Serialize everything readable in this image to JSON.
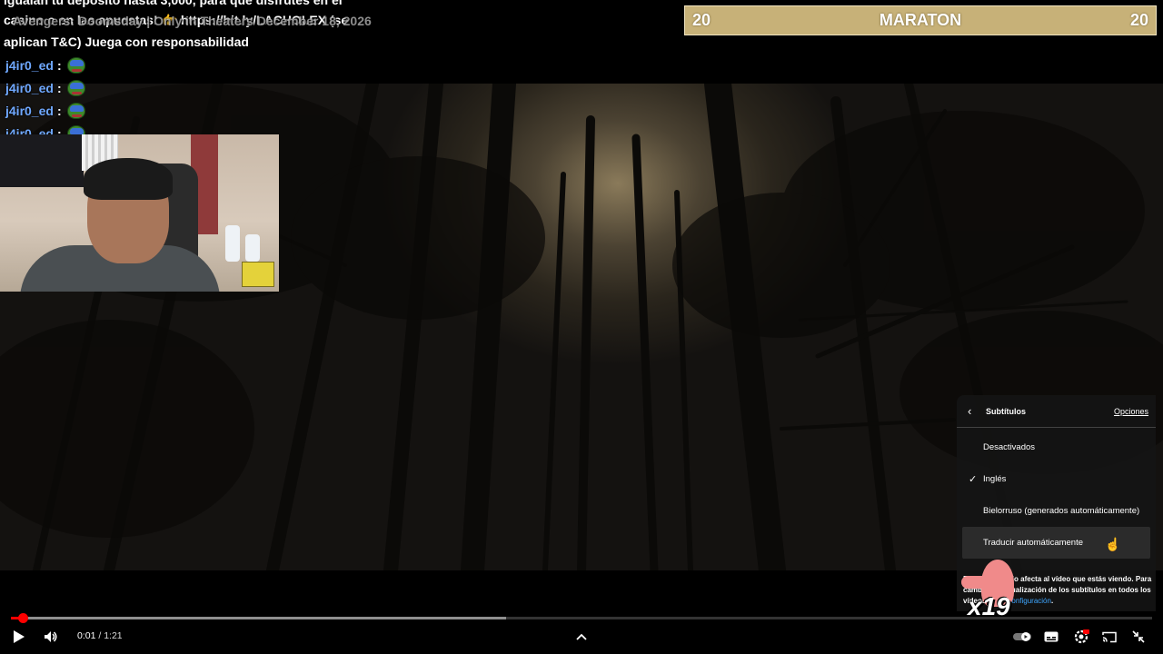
{
  "chat": {
    "headline_line1": "igualan tu depósito hasta 3,000, para que disfrutes en el",
    "headline_line2": "casino o en las apuestas! 👉 https://bit.ly/LACHOLEX (se",
    "headline_line3": "aplican T&C) Juega con responsabilidad",
    "headline_ghost": "Avengers: Doomsday | Only in Theaters December 18, 2026",
    "messages": [
      {
        "user": "j4ir0_ed",
        "sep": ":"
      },
      {
        "user": "j4ir0_ed",
        "sep": ":"
      },
      {
        "user": "j4ir0_ed",
        "sep": ":"
      },
      {
        "user": "j4ir0_ed",
        "sep": ":"
      }
    ]
  },
  "banner": {
    "left_number": "20",
    "title": "MARATON",
    "right_number": "20"
  },
  "subtitles_menu": {
    "title": "Subtítulos",
    "options_link": "Opciones",
    "items": [
      {
        "label": "Desactivados",
        "checked": false
      },
      {
        "label": "Inglés",
        "checked": true
      },
      {
        "label": "Bielorruso (generados automáticamente)",
        "checked": false
      },
      {
        "label": "Traducir automáticamente",
        "checked": false
      }
    ],
    "note_part1": "Este ajuste solo afecta al vídeo que estás viendo.",
    "note_part2": "Para cambiar la visualización de los subtítulos en todos los vídeos, ve a",
    "note_link": "Configuración",
    "note_end": "."
  },
  "overlay": {
    "multiplier": "x19"
  },
  "player": {
    "time_current": "0:01",
    "time_sep": " / ",
    "time_total": "1:21",
    "progress_played": 0.01,
    "progress_buffered": 0.434
  },
  "icons": {
    "play": "play-icon",
    "volume": "volume-icon",
    "chevron_up": "chevron-up-icon",
    "autoplay": "autoplay-toggle-icon",
    "subtitles": "subtitles-icon",
    "settings": "settings-icon",
    "cast": "cast-icon",
    "exit_fullscreen": "exit-fullscreen-icon"
  },
  "colors": {
    "accent_red": "#ff0000",
    "link_blue": "#3ea6ff",
    "chat_user": "#6fa8ff",
    "banner_gold": "#c7b178"
  }
}
